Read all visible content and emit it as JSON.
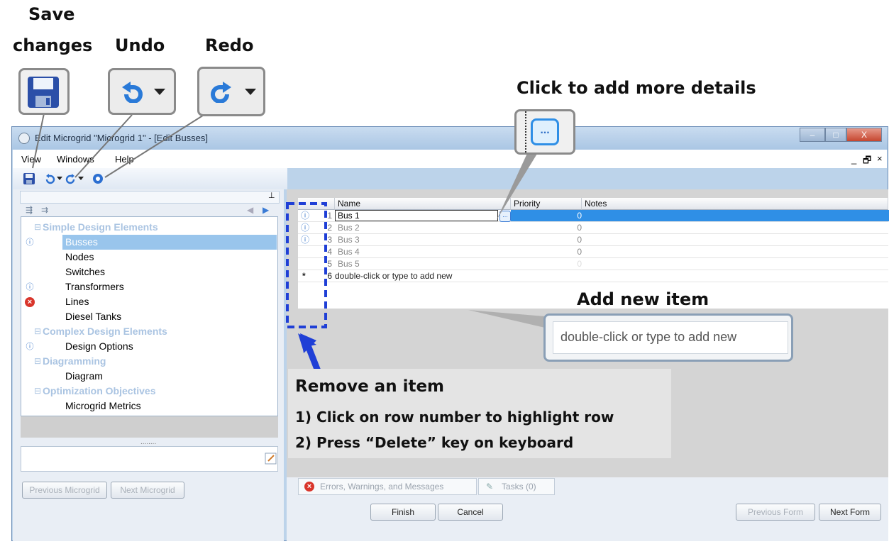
{
  "annotations": {
    "save_title": "Save",
    "save_title2": "changes",
    "undo_title": "Undo",
    "redo_title": "Redo",
    "details_title": "Click to add more details",
    "add_title": "Add new item",
    "add_box_text": "double-click or type to add new",
    "remove_title": "Remove an item",
    "remove_step1": "1) Click on row number to highlight row",
    "remove_step2": "2) Press “Delete” key on keyboard"
  },
  "window": {
    "title": "Edit Microgrid \"Microgrid 1\" - [Edit Busses]",
    "controls": [
      "–",
      "□",
      "X"
    ]
  },
  "menu": [
    "View",
    "Windows",
    "Help"
  ],
  "mdi_controls": [
    "_",
    "🗗",
    "×"
  ],
  "tree": {
    "groups": [
      {
        "label": "Simple Design Elements",
        "items": [
          "Busses",
          "Nodes",
          "Switches",
          "Transformers",
          "Lines",
          "Diesel Tanks"
        ]
      },
      {
        "label": "Complex Design Elements",
        "items": [
          "Design Options"
        ]
      },
      {
        "label": "Diagramming",
        "items": [
          "Diagram"
        ]
      },
      {
        "label": "Optimization Objectives",
        "items": [
          "Microgrid Metrics"
        ]
      }
    ],
    "selected": "Busses",
    "splitter": "........"
  },
  "grid": {
    "headers": [
      "Name",
      "Priority",
      "Notes"
    ],
    "rows": [
      {
        "num": "1",
        "name": "Bus 1",
        "priority": "0"
      },
      {
        "num": "2",
        "name": "Bus 2",
        "priority": "0"
      },
      {
        "num": "3",
        "name": "Bus 3",
        "priority": "0"
      },
      {
        "num": "4",
        "name": "Bus 4",
        "priority": "0"
      },
      {
        "num": "5",
        "name": "Bus 5",
        "priority": "0"
      },
      {
        "num": "6",
        "name": "double-click or type to add new",
        "priority": ""
      }
    ],
    "new_row_marker": "*",
    "ellipsis": "..."
  },
  "tabs": {
    "errors": "Errors, Warnings, and Messages",
    "tasks": "Tasks (0)"
  },
  "buttons": {
    "prev_microgrid": "Previous Microgrid",
    "next_microgrid": "Next Microgrid",
    "finish": "Finish",
    "cancel": "Cancel",
    "prev_form": "Previous Form",
    "next_form": "Next Form"
  },
  "colors": {
    "accent_blue": "#2f8fe6",
    "annotation_dash": "#1f3fd6",
    "error_red": "#d9352b"
  }
}
